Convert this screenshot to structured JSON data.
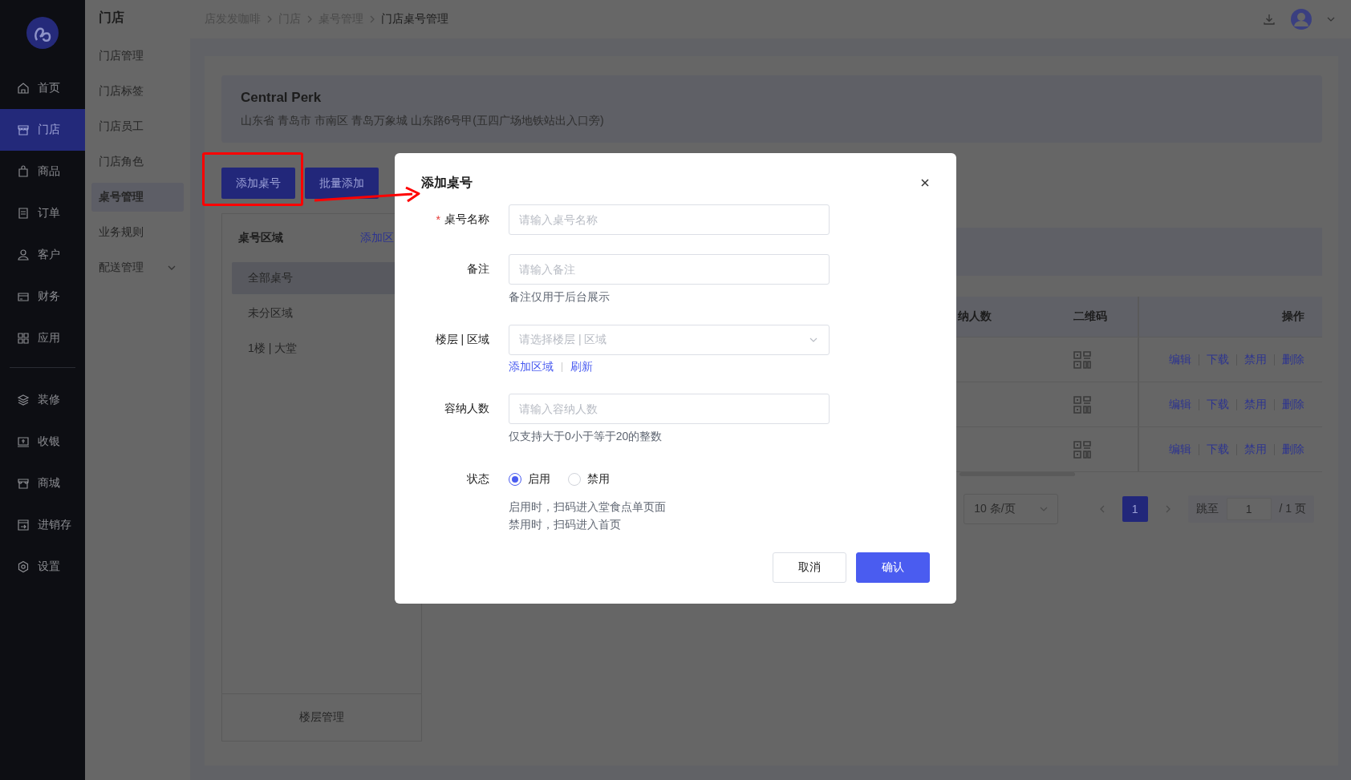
{
  "sidebar": {
    "sections": [
      {
        "items": [
          {
            "label": "首页",
            "selected": false
          },
          {
            "label": "门店",
            "selected": true
          },
          {
            "label": "商品",
            "selected": false
          },
          {
            "label": "订单",
            "selected": false
          },
          {
            "label": "客户",
            "selected": false
          },
          {
            "label": "财务",
            "selected": false
          },
          {
            "label": "应用",
            "selected": false
          }
        ]
      },
      {
        "items": [
          {
            "label": "装修",
            "selected": false
          },
          {
            "label": "收银",
            "selected": false
          },
          {
            "label": "商城",
            "selected": false
          },
          {
            "label": "进销存",
            "selected": false
          },
          {
            "label": "设置",
            "selected": false
          }
        ]
      }
    ]
  },
  "subnav": {
    "title": "门店",
    "items": [
      {
        "label": "门店管理",
        "selected": false
      },
      {
        "label": "门店标签",
        "selected": false
      },
      {
        "label": "门店员工",
        "selected": false
      },
      {
        "label": "门店角色",
        "selected": false
      },
      {
        "label": "桌号管理",
        "selected": true
      },
      {
        "label": "业务规则",
        "selected": false
      },
      {
        "label": "配送管理",
        "selected": false,
        "expandable": true
      }
    ]
  },
  "breadcrumb": [
    "店发发咖啡",
    "门店",
    "桌号管理",
    "门店桌号管理"
  ],
  "store": {
    "name": "Central Perk",
    "address": "山东省 青岛市 市南区 青岛万象城 山东路6号甲(五四广场地铁站出入口旁)"
  },
  "actions": [
    "添加桌号",
    "批量添加"
  ],
  "areas": {
    "title": "桌号区域",
    "link": "添加区",
    "items": [
      {
        "label": "全部桌号",
        "selected": true
      },
      {
        "label": "未分区域",
        "selected": false
      },
      {
        "label": "1楼 | 大堂",
        "selected": false
      }
    ],
    "footer": "楼层管理"
  },
  "table": {
    "columns": [
      "纳人数",
      "二维码",
      "操作"
    ],
    "rows": [
      {
        "actions": [
          "编辑",
          "下载",
          "禁用",
          "删除"
        ]
      },
      {
        "actions": [
          "编辑",
          "下载",
          "禁用",
          "删除"
        ]
      },
      {
        "actions": [
          "编辑",
          "下载",
          "禁用",
          "删除"
        ]
      }
    ]
  },
  "pagination": {
    "page_size": "10 条/页",
    "pages": [
      {
        "label": "1",
        "selected": true
      }
    ],
    "jump_label": "跳至",
    "jump_value": "1",
    "total": "/ 1 页"
  },
  "dialog": {
    "title": "添加桌号",
    "fields": [
      {
        "kind": "input",
        "label": "桌号名称",
        "required_mark": "*",
        "placeholder": "请输入桌号名称"
      },
      {
        "kind": "input",
        "label": "备注",
        "placeholder": "请输入备注",
        "hints": [
          "备注仅用于后台展示"
        ]
      },
      {
        "kind": "select",
        "label": "楼层 | 区域",
        "placeholder": "请选择楼层 | 区域",
        "links": [
          "添加区域",
          "刷新"
        ]
      },
      {
        "kind": "input",
        "label": "容纳人数",
        "placeholder": "请输入容纳人数",
        "hints": [
          "仅支持大于0小于等于20的整数"
        ]
      },
      {
        "kind": "radio",
        "label": "状态",
        "options": [
          {
            "label": "启用",
            "selected": true
          },
          {
            "label": "禁用",
            "selected": false
          }
        ],
        "hints": [
          "启用时，扫码进入堂食点单页面",
          "禁用时，扫码进入首页"
        ]
      }
    ],
    "buttons": [
      {
        "label": "取消",
        "kind": "secondary"
      },
      {
        "label": "确认",
        "kind": "primary"
      }
    ]
  }
}
